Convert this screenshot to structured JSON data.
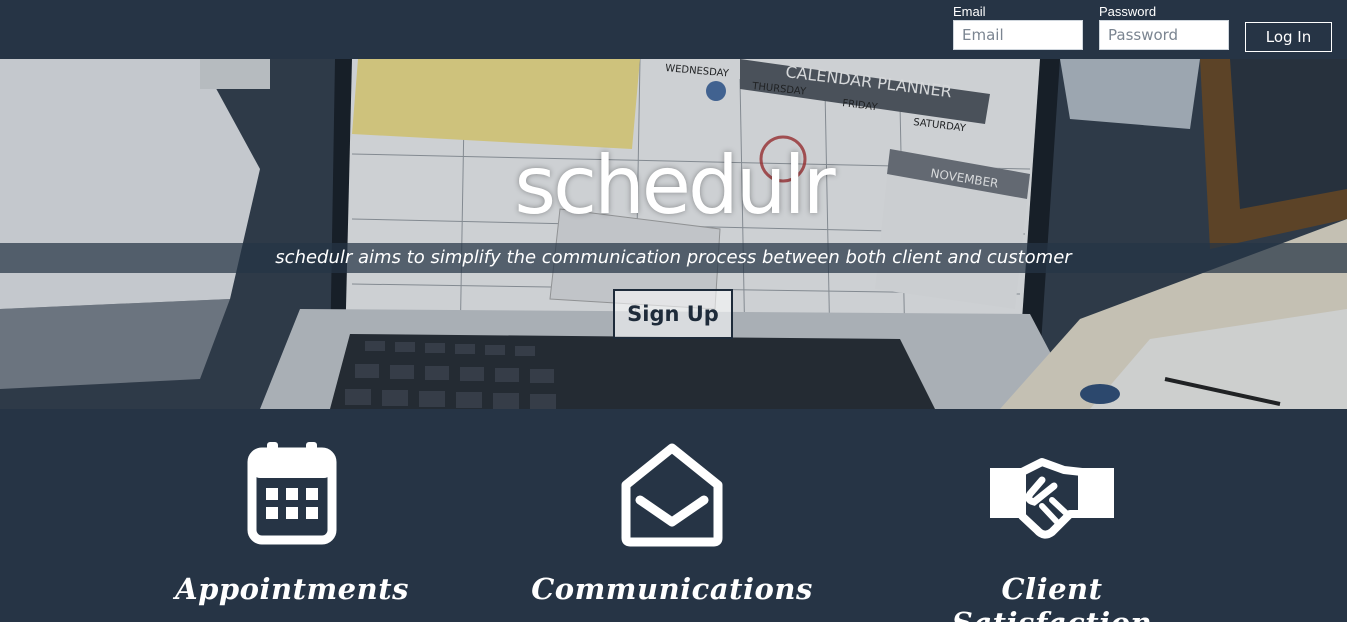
{
  "header": {
    "email_label": "Email",
    "email_placeholder": "Email",
    "password_label": "Password",
    "password_placeholder": "Password",
    "login_label": "Log In"
  },
  "hero": {
    "title": "schedulr",
    "tagline": "schedulr aims to simplify the communication process between both client and customer",
    "signup_label": "Sign Up",
    "background_image": {
      "calendar_heading": "CALENDAR PLANNER",
      "days": [
        "WEDNESDAY",
        "THURSDAY",
        "FRIDAY",
        "SATURDAY"
      ],
      "mini_month": "NOVEMBER"
    }
  },
  "features": [
    {
      "icon": "calendar-icon",
      "title": "Appointments"
    },
    {
      "icon": "envelope-open-icon",
      "title": "Communications"
    },
    {
      "icon": "handshake-icon",
      "title": "Client Satisfaction"
    }
  ],
  "colors": {
    "background": "#263445",
    "text": "#ffffff",
    "button_dark": "#1e2b3a"
  }
}
